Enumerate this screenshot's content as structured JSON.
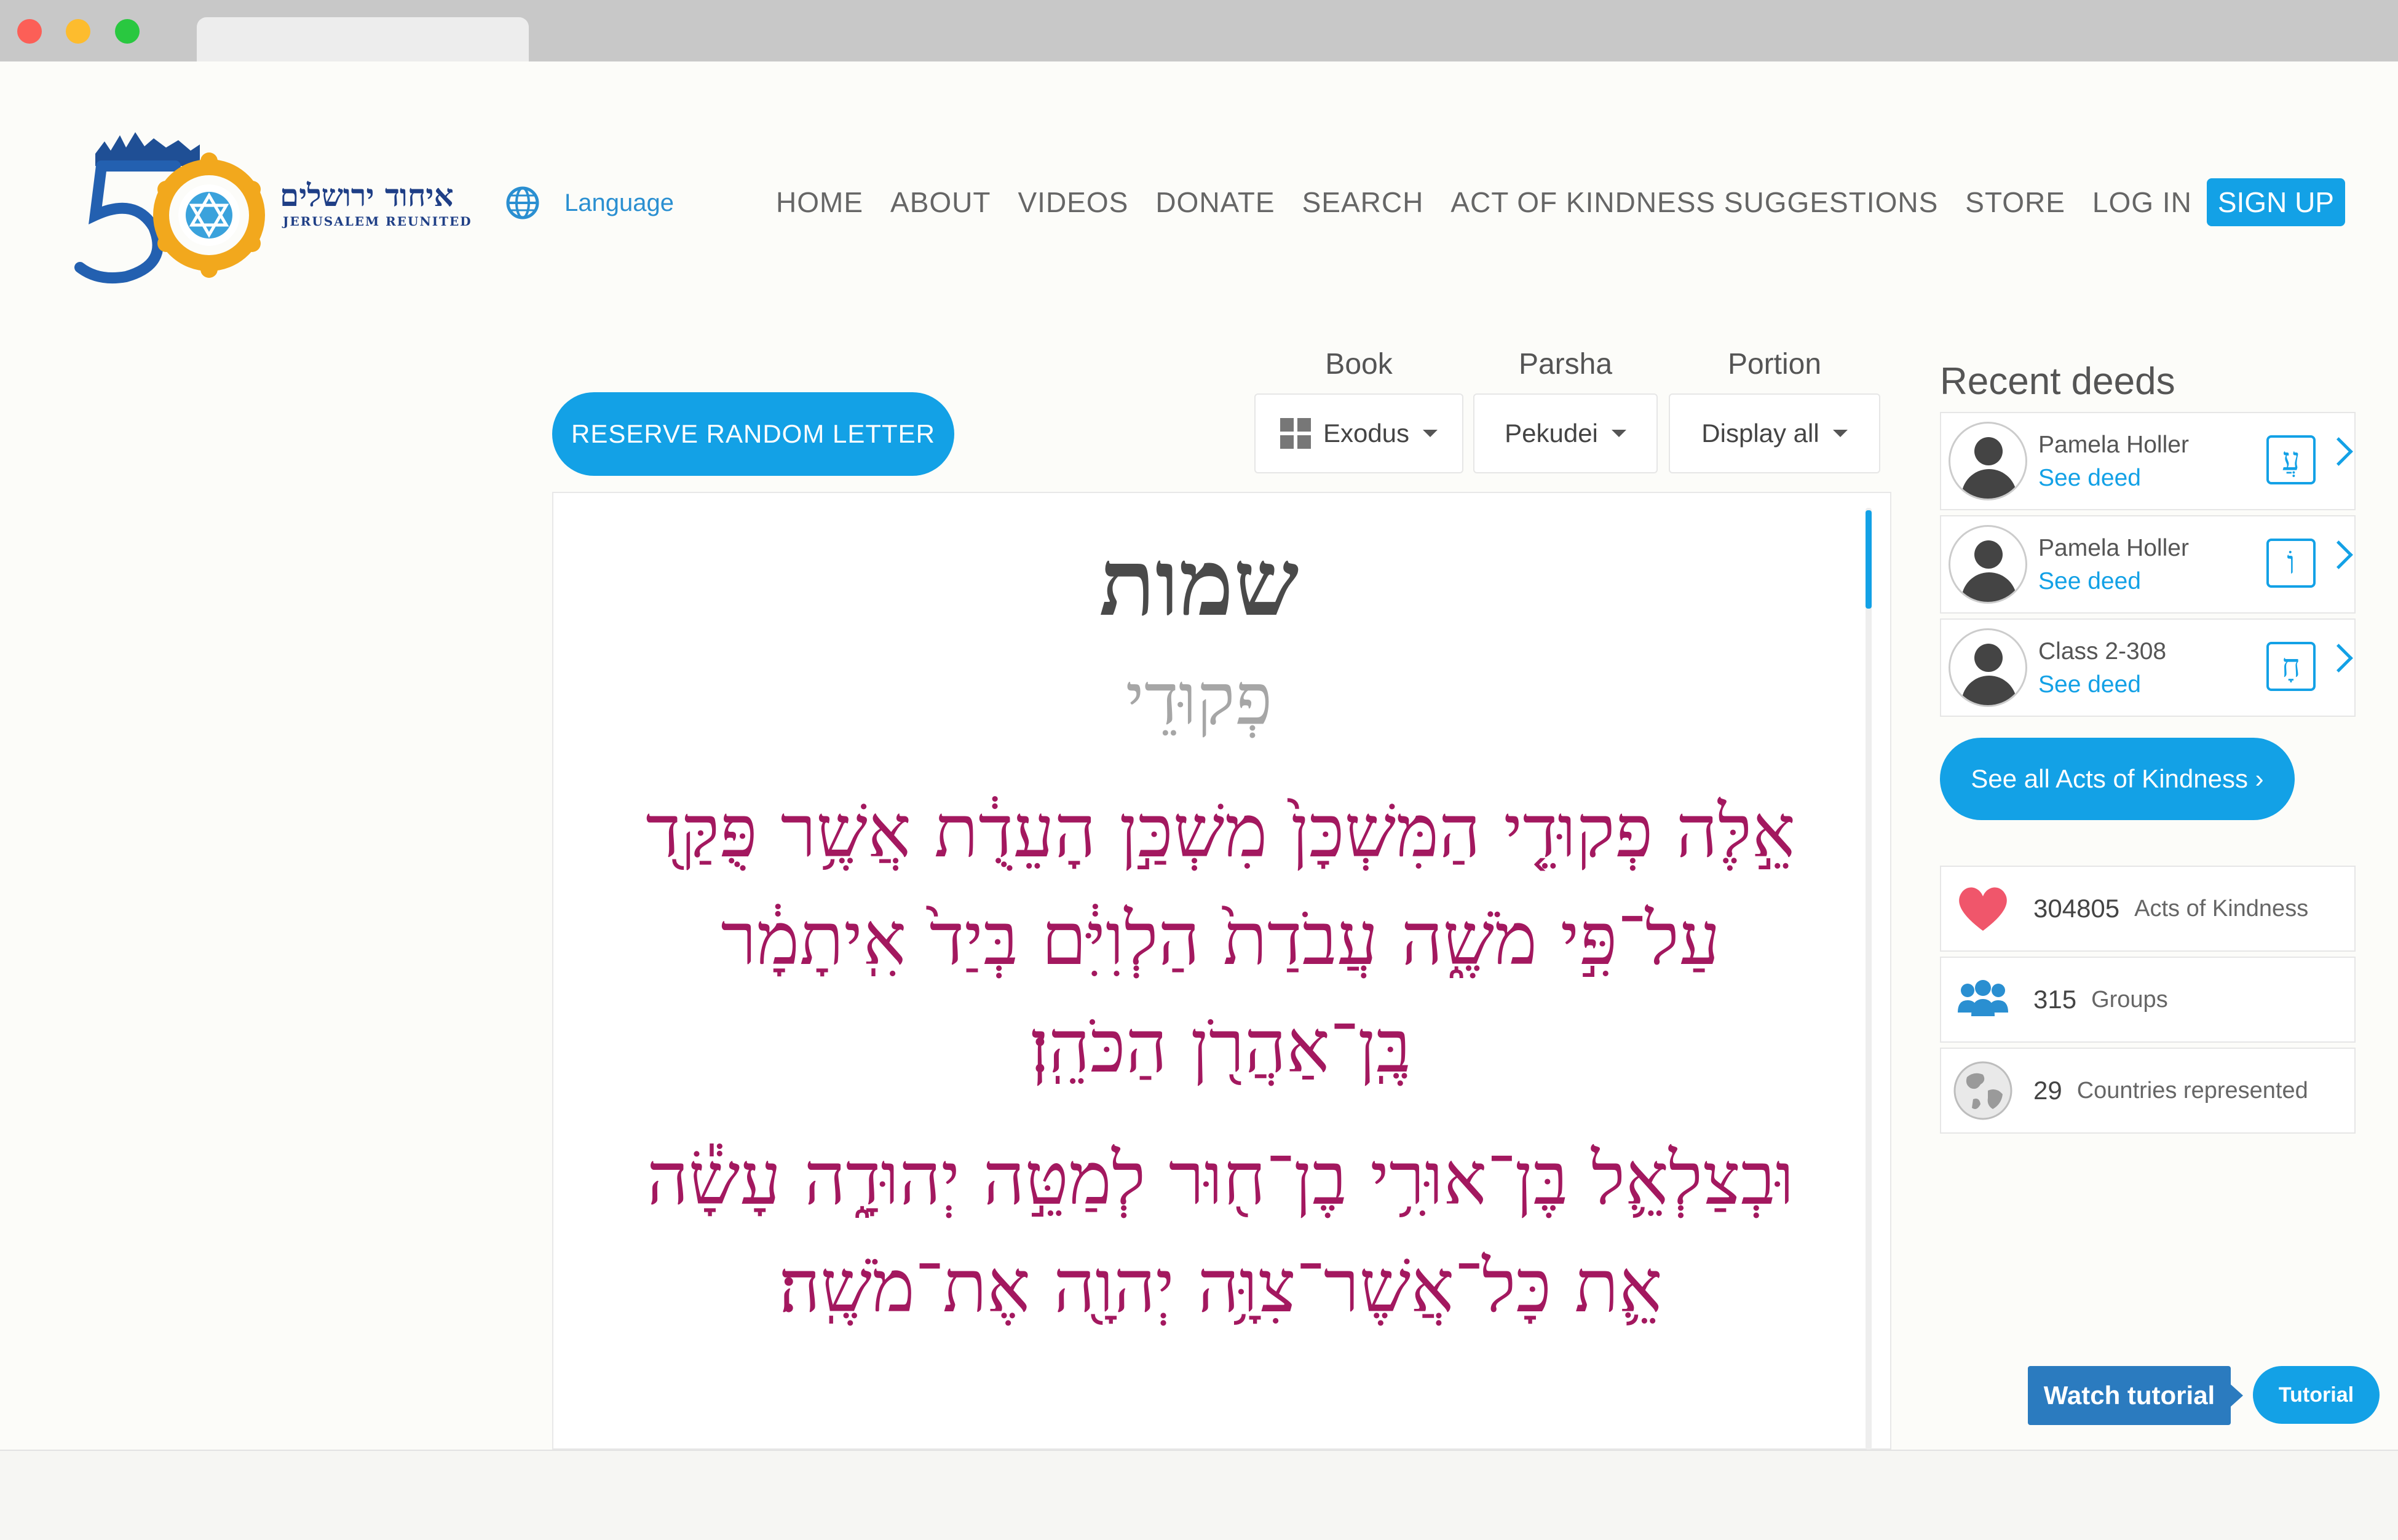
{
  "header": {
    "logo_hebrew": "איחוד ירושלים",
    "logo_english": "JERUSALEM REUNITED",
    "logo_number": "5",
    "language_label": "Language",
    "nav": [
      "HOME",
      "ABOUT",
      "VIDEOS",
      "DONATE",
      "SEARCH",
      "ACT OF KINDNESS SUGGESTIONS",
      "STORE",
      "LOG IN"
    ],
    "signup_label": "SIGN UP"
  },
  "selectors": {
    "book_label": "Book",
    "book_value": "Exodus",
    "parsha_label": "Parsha",
    "parsha_value": "Pekudei",
    "portion_label": "Portion",
    "portion_value": "Display all",
    "reserve_label": "RESERVE RANDOM LETTER"
  },
  "text": {
    "book_hebrew": "שמות",
    "parsha_hebrew": "פְקוּדֵי",
    "verse1": "אֵ֣לֶּה פְקוּדֵ֤י הַמִּשְׁכָּן֙ מִשְׁכַּ֣ן הָעֵדֻ֔ת אֲשֶׁ֥ר פֻּקַּ֖ד עַל־פִּ֣י מֹשֶׁ֑ה עֲבֹדַת֙ הַלְוִיִּ֔ם בְּיַד֙ אִֽיתָמָ֔ר בֶּֽן־אַהֲרֹ֖ן הַכֹּהֵֽן׃",
    "verse2": "וּבְצַלְאֵ֛ל בֶּן־אוּרִ֥י בֶן־ח֖וּר לְמַטֵּ֣ה יְהוּדָ֑ה עָשָׂ֕ה אֵ֛ת כָּל־אֲשֶׁר־צִוָּ֥ה יְהוָ֖ה אֶת־מֹשֶֽׁה׃"
  },
  "sidebar": {
    "recent_title": "Recent deeds",
    "deeds": [
      {
        "name": "Pamela Holler",
        "link": "See deed",
        "letter": "עֲ"
      },
      {
        "name": "Pamela Holler",
        "link": "See deed",
        "letter": "וֹ"
      },
      {
        "name": "Class 2-308",
        "link": "See deed",
        "letter": "חָ"
      }
    ],
    "see_all_label": "See all Acts of Kindness ›",
    "stats": [
      {
        "icon": "heart-icon",
        "value": "304805",
        "label": "Acts of Kindness",
        "color": "#f0566b"
      },
      {
        "icon": "users-icon",
        "value": "315",
        "label": "Groups",
        "color": "#2a8fd1"
      },
      {
        "icon": "globe-icon",
        "value": "29",
        "label": "Countries represented",
        "color": "#9a9a9a"
      }
    ]
  },
  "tutorial": {
    "watch_label": "Watch tutorial",
    "tutorial_label": "Tutorial"
  },
  "colors": {
    "accent": "#13a1e6",
    "verse": "#a3185f"
  }
}
